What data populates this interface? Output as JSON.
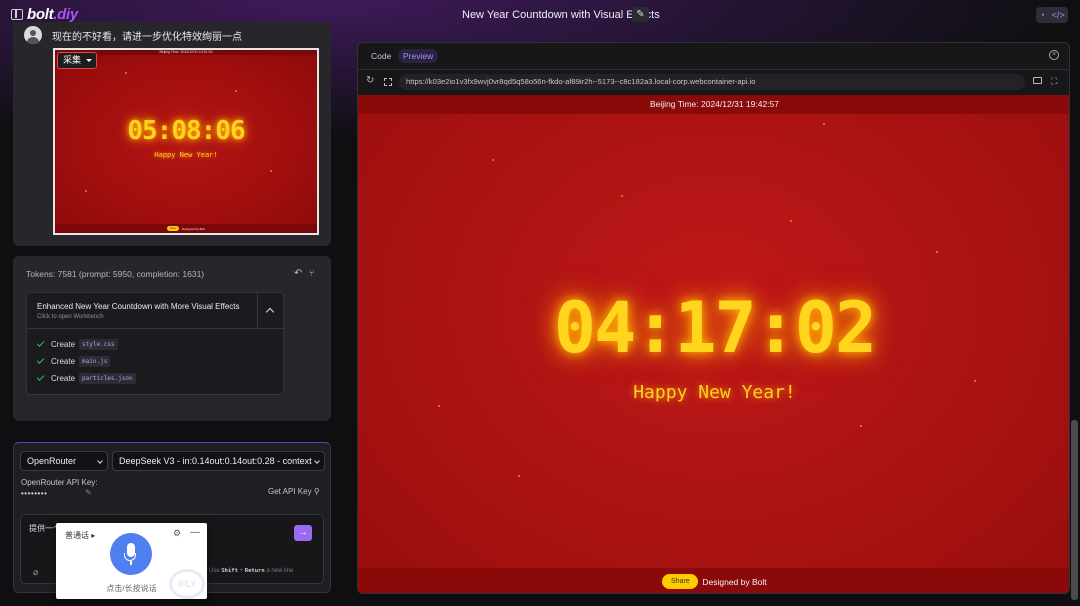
{
  "header": {
    "logo_main": "bolt",
    "logo_dot": ".diy",
    "title": "New Year Countdown with Visual Effects",
    "edit_icon": "pencil-icon",
    "right_buttons": [
      "chat-icon",
      "code-icon"
    ]
  },
  "message": {
    "text": "现在的不好看，请进一步优化特效绚丽一点",
    "thumbnail": {
      "collect_label": "采集",
      "countdown": "05:08:06",
      "greeting": "Happy New Year!",
      "time_bar": "Beijing Time: 2024/12/31 19:51:53",
      "share": "Share",
      "designed": "Designed by Bolt"
    }
  },
  "tokens": {
    "summary": "Tokens: 7581 (prompt: 5950, completion: 1631)"
  },
  "artifact": {
    "title": "Enhanced New Year Countdown with More Visual Effects",
    "subtitle": "Click to open Workbench",
    "actions": [
      {
        "verb": "Create",
        "file": "style.css"
      },
      {
        "verb": "Create",
        "file": "main.js"
      },
      {
        "verb": "Create",
        "file": "particles.json"
      }
    ]
  },
  "input": {
    "provider": "OpenRouter",
    "model": "DeepSeek V3 - in:0.14out:0.14out:0.28 - context",
    "api_key_label": "OpenRouter API Key:",
    "api_key_mask": "••••••••",
    "get_api_key": "Get API Key",
    "prompt_text": "提供一个",
    "hint_use": "Use",
    "hint_shift": "Shift",
    "hint_plus": "+",
    "hint_return": "Return",
    "hint_newline": "a new line",
    "send_label": "→"
  },
  "voice": {
    "language": "普通话",
    "hint": "点击/长按说话",
    "watermark": "iFLY"
  },
  "workbench": {
    "tab_code": "Code",
    "tab_preview": "Preview",
    "url": "https://k03e2io1v3fx9wvj0vr8qd5q58o56n-fkdo-af89ir2h--5173--c8c182a3.local-corp.webcontainer-api.io",
    "beijing_time": "Beijing Time: 2024/12/31 19:42:57",
    "countdown": "04:17:02",
    "greeting": "Happy New Year!",
    "share": "Share",
    "designed": "Designed by Bolt"
  },
  "colors": {
    "accent": "#a855f7",
    "stage_red": "#b01414",
    "countdown_gold": "#ffd51e",
    "share_yellow": "#ffcc00"
  }
}
